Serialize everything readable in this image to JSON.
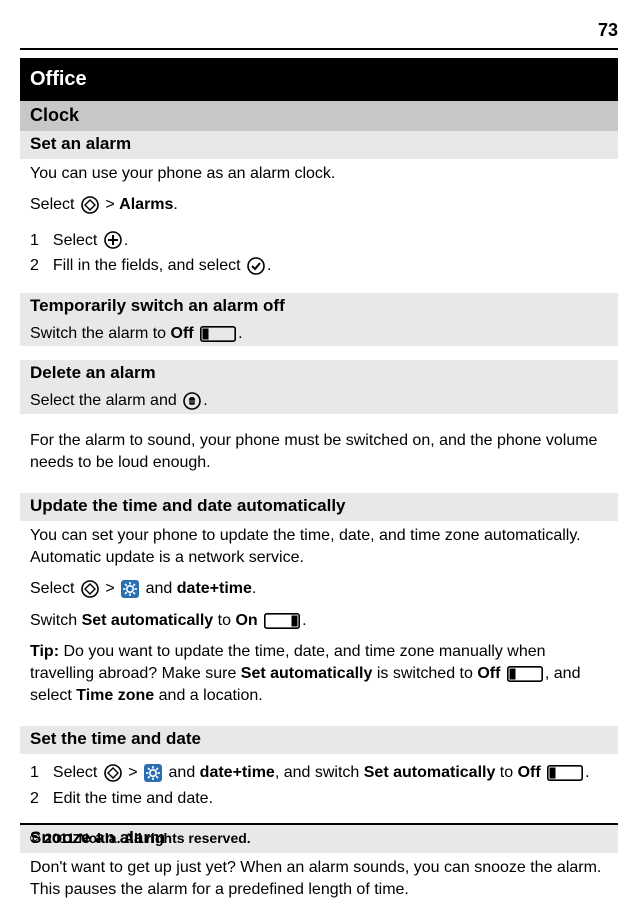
{
  "page_number": "73",
  "chapter": "Office",
  "clock_heading": "Clock",
  "set_alarm": {
    "heading": "Set an alarm",
    "intro": "You can use your phone as an alarm clock.",
    "select_pre": "Select ",
    "gt": " > ",
    "alarms": "Alarms",
    "steps": [
      {
        "n": "1",
        "pre": "Select ",
        "post": "."
      },
      {
        "n": "2",
        "pre": "Fill in the fields, and select ",
        "post": "."
      }
    ]
  },
  "temp_off": {
    "heading": "Temporarily switch an alarm off",
    "pre": "Switch the alarm to ",
    "off": "Off",
    "post": "."
  },
  "delete": {
    "heading": "Delete an alarm",
    "pre": "Select the alarm and ",
    "post": "."
  },
  "note1": "For the alarm to sound, your phone must be switched on, and the phone volume needs to be loud enough.",
  "auto": {
    "heading": "Update the time and date automatically",
    "intro": "You can set your phone to update the time, date, and time zone automatically. Automatic update is a network service.",
    "select_pre": "Select ",
    "gt": " > ",
    "and": " and ",
    "datetime": "date+time",
    "switch_pre": "Switch ",
    "set_auto": "Set automatically",
    "to": " to ",
    "on": "On",
    "tip_label": "Tip:",
    "tip_body_pre": " Do you want to update the time, date, and time zone manually when travelling abroad? Make sure ",
    "tip_body_mid": " is switched to ",
    "off": "Off",
    "tip_body_post1": ", and select ",
    "timezone": "Time zone",
    "tip_body_post2": " and a location."
  },
  "set_td": {
    "heading": "Set the time and date",
    "s1_pre": "Select ",
    "gt": " > ",
    "and": " and ",
    "datetime": "date+time",
    "s1_mid1": ", and switch ",
    "set_auto": "Set automatically",
    "s1_mid2": " to ",
    "off": "Off",
    "s1_post": ".",
    "s2": "Edit the time and date."
  },
  "snooze": {
    "heading": "Snooze an alarm",
    "body": "Don't want to get up just yet? When an alarm sounds, you can snooze the alarm. This pauses the alarm for a predefined length of time."
  },
  "footer": "© 2011 Nokia. All rights reserved."
}
